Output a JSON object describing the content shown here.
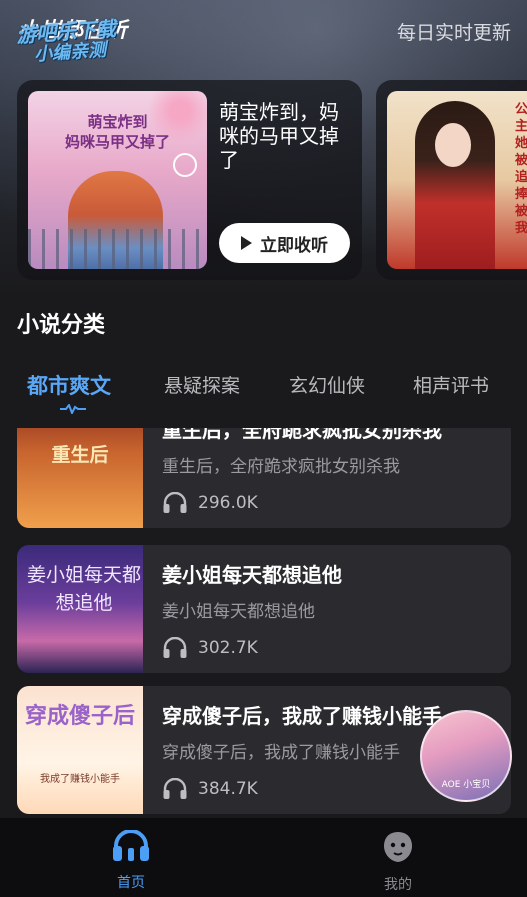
{
  "header": {
    "logo_text": "小岩都在听",
    "watermark_line1": "游吧乐下载",
    "watermark_line2": "小编亲测",
    "daily_update": "每日实时更新"
  },
  "featured": {
    "title": "萌宝炸到，妈咪的马甲又掉了",
    "cover_text_line1": "萌宝炸到",
    "cover_text_line2": "妈咪马甲又掉了",
    "listen_label": "立即收听"
  },
  "featured_next": {
    "cover_text": "公主她被追捧被我"
  },
  "section": {
    "title": "小说分类"
  },
  "tabs": [
    {
      "label": "都市爽文",
      "active": true
    },
    {
      "label": "悬疑探案",
      "active": false
    },
    {
      "label": "玄幻仙侠",
      "active": false
    },
    {
      "label": "相声评书",
      "active": false
    }
  ],
  "books": [
    {
      "title": "重生后，全府跪求疯批女别杀我",
      "subtitle": "重生后，全府跪求疯批女别杀我",
      "plays": "296.0K",
      "cover_text": "重生后"
    },
    {
      "title": "姜小姐每天都想追他",
      "subtitle": "姜小姐每天都想追他",
      "plays": "302.7K",
      "cover_text": "姜小姐每天都想追他"
    },
    {
      "title": "穿成傻子后，我成了赚钱小能手",
      "subtitle": "穿成傻子后，我成了赚钱小能手",
      "plays": "384.7K",
      "cover_text": "穿成傻子后",
      "cover_sub": "我成了赚钱小能手"
    }
  ],
  "floating_player": {
    "caption": "AOE 小宝贝"
  },
  "bottom_nav": [
    {
      "label": "首页",
      "icon": "headphones-icon",
      "active": true
    },
    {
      "label": "我的",
      "icon": "profile-face-icon",
      "active": false
    }
  ],
  "colors": {
    "accent": "#4d9ef5",
    "background": "#1a1a1c",
    "card": "#2b2b2f"
  }
}
